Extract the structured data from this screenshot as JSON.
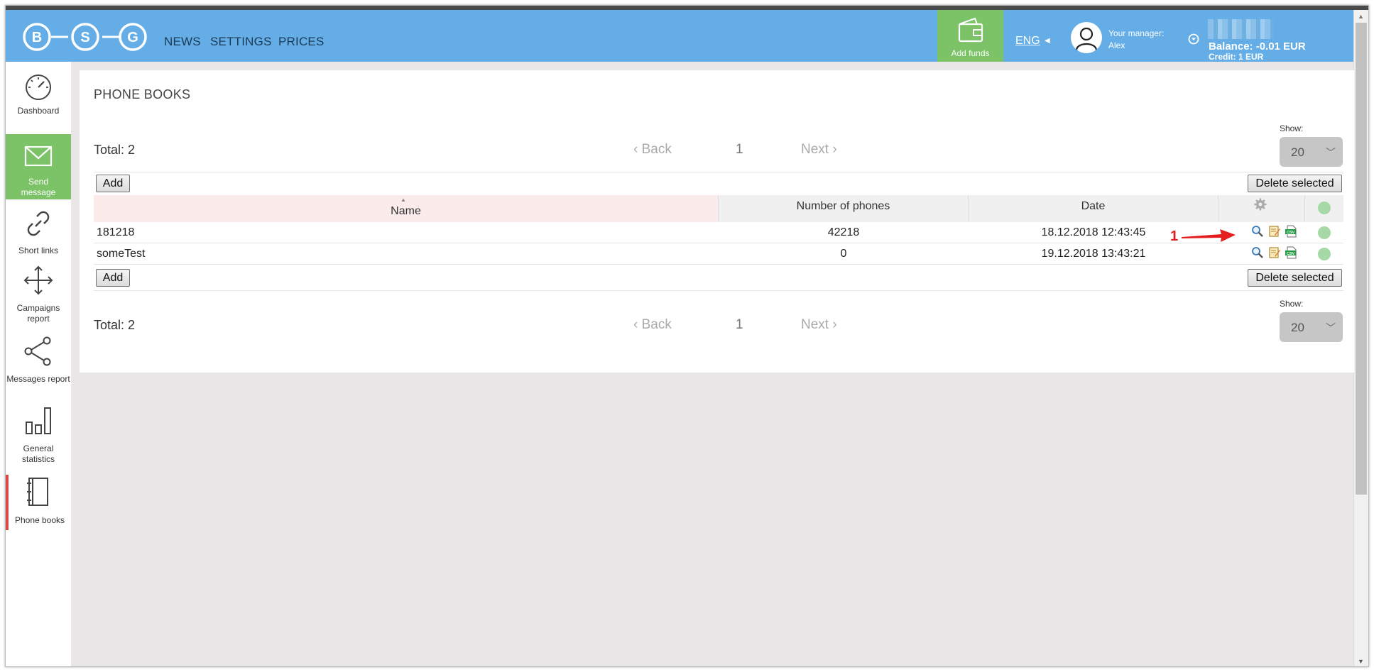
{
  "header": {
    "logo_letters": [
      "B",
      "S",
      "G"
    ],
    "nav": [
      "NEWS",
      "SETTINGS",
      "PRICES"
    ],
    "add_funds": "Add funds",
    "language": "ENG",
    "manager_label": "Your manager:",
    "manager_name": "Alex",
    "balance": "Balance: -0.01 EUR",
    "credit": "Credit: 1 EUR",
    "colors": {
      "bar": "#64ade6",
      "add_funds": "#7cc267"
    }
  },
  "sidebar": {
    "items": [
      {
        "label": "Dashboard",
        "icon": "speedometer-icon"
      },
      {
        "label": "Send message",
        "icon": "envelope-icon",
        "active": true
      },
      {
        "label": "Short links",
        "icon": "link-icon"
      },
      {
        "label": "Campaigns report",
        "icon": "move-arrows-icon"
      },
      {
        "label": "Messages report",
        "icon": "share-icon"
      },
      {
        "label": "General statistics",
        "icon": "bar-chart-icon"
      },
      {
        "label": "Phone books",
        "icon": "notebook-icon",
        "selected": true
      }
    ]
  },
  "main": {
    "title": "PHONE BOOKS",
    "total": "Total: 2",
    "pager": {
      "back": "Back",
      "page": "1",
      "next": "Next"
    },
    "show_label": "Show:",
    "show_value": "20",
    "add_label": "Add",
    "delete_label": "Delete selected",
    "columns": [
      "Name",
      "Number of phones",
      "Date"
    ],
    "rows": [
      {
        "name": "181218",
        "phones": "42218",
        "date": "18.12.2018 12:43:45"
      },
      {
        "name": "someTest",
        "phones": "0",
        "date": "19.12.2018 13:43:21"
      }
    ]
  },
  "annotation": {
    "number": "1"
  }
}
